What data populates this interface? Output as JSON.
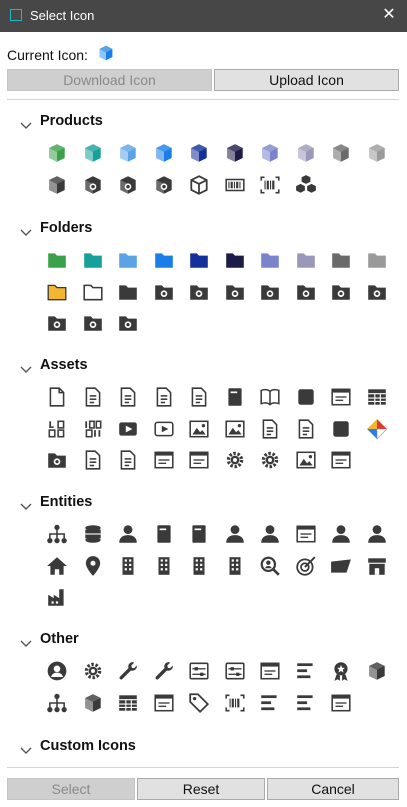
{
  "window": {
    "title": "Select Icon",
    "close_glyph": "✕"
  },
  "current": {
    "label": "Current Icon:",
    "icon": "cube-blue-icon"
  },
  "buttons": {
    "download": "Download Icon",
    "upload": "Upload Icon",
    "select": "Select",
    "reset": "Reset",
    "cancel": "Cancel"
  },
  "sections": [
    {
      "label": "Products",
      "icons": [
        {
          "name": "cube-green-icon",
          "kind": "cube",
          "color": "#3aa04a"
        },
        {
          "name": "cube-teal-icon",
          "kind": "cube",
          "color": "#16a09a"
        },
        {
          "name": "cube-lightblue-icon",
          "kind": "cube",
          "color": "#5aa4e6"
        },
        {
          "name": "cube-blue-icon",
          "kind": "cube",
          "color": "#1a7ee8"
        },
        {
          "name": "cube-navy-icon",
          "kind": "cube",
          "color": "#14309a"
        },
        {
          "name": "cube-darknavy-icon",
          "kind": "cube",
          "color": "#1c1c48"
        },
        {
          "name": "cube-periwinkle-icon",
          "kind": "cube",
          "color": "#7a84cc"
        },
        {
          "name": "cube-lavender-icon",
          "kind": "cube",
          "color": "#9a98b8"
        },
        {
          "name": "cube-gray-icon",
          "kind": "cube",
          "color": "#6a6a6a"
        },
        {
          "name": "cube-lightgray-icon",
          "kind": "cube",
          "color": "#9a9a9a"
        },
        {
          "name": "cube-dark-icon",
          "kind": "cube",
          "color": "#3a3a3a"
        },
        {
          "name": "cube-import-icon",
          "kind": "cube-badge",
          "color": "#3a3a3a"
        },
        {
          "name": "cube-star-icon",
          "kind": "cube-badge",
          "color": "#3a3a3a"
        },
        {
          "name": "cube-blocked-icon",
          "kind": "cube-badge",
          "color": "#3a3a3a"
        },
        {
          "name": "cube-outline-icon",
          "kind": "cube-outline",
          "color": "#3a3a3a"
        },
        {
          "name": "barcode-icon",
          "kind": "barcode",
          "color": "#3a3a3a"
        },
        {
          "name": "barcode-scan-icon",
          "kind": "barcode-scan",
          "color": "#3a3a3a"
        },
        {
          "name": "cubes-stack-icon",
          "kind": "cubes",
          "color": "#3a3a3a"
        }
      ]
    },
    {
      "label": "Folders",
      "icons": [
        {
          "name": "folder-green-icon",
          "kind": "folder",
          "color": "#3aa04a"
        },
        {
          "name": "folder-teal-icon",
          "kind": "folder",
          "color": "#16a09a"
        },
        {
          "name": "folder-lightblue-icon",
          "kind": "folder",
          "color": "#5aa4e6"
        },
        {
          "name": "folder-blue-icon",
          "kind": "folder",
          "color": "#1a7ee8"
        },
        {
          "name": "folder-navy-icon",
          "kind": "folder",
          "color": "#14309a"
        },
        {
          "name": "folder-darknavy-icon",
          "kind": "folder",
          "color": "#1c1c48"
        },
        {
          "name": "folder-periwinkle-icon",
          "kind": "folder",
          "color": "#7a84cc"
        },
        {
          "name": "folder-lavender-icon",
          "kind": "folder",
          "color": "#9a98b8"
        },
        {
          "name": "folder-gray-icon",
          "kind": "folder",
          "color": "#6a6a6a"
        },
        {
          "name": "folder-lightgray-icon",
          "kind": "folder",
          "color": "#9a9a9a"
        },
        {
          "name": "folder-yellow-icon",
          "kind": "folder-outlined",
          "color": "#f2b632"
        },
        {
          "name": "folder-outline-icon",
          "kind": "folder-empty",
          "color": "#3a3a3a"
        },
        {
          "name": "folder-dark-icon",
          "kind": "folder",
          "color": "#3a3a3a"
        },
        {
          "name": "folder-arrow-icon",
          "kind": "folder-badge",
          "color": "#3a3a3a"
        },
        {
          "name": "folder-star-icon",
          "kind": "folder-badge",
          "color": "#3a3a3a"
        },
        {
          "name": "folder-blocked-icon",
          "kind": "folder-badge",
          "color": "#3a3a3a"
        },
        {
          "name": "folder-code-icon",
          "kind": "folder-badge",
          "color": "#3a3a3a"
        },
        {
          "name": "folder-question-icon",
          "kind": "folder-badge",
          "color": "#3a3a3a"
        },
        {
          "name": "folder-dollar-icon",
          "kind": "folder-badge",
          "color": "#3a3a3a"
        },
        {
          "name": "folder-database-icon",
          "kind": "folder-badge",
          "color": "#3a3a3a"
        },
        {
          "name": "folder-user-icon",
          "kind": "folder-badge",
          "color": "#3a3a3a"
        },
        {
          "name": "folder-home-icon",
          "kind": "folder-badge",
          "color": "#3a3a3a"
        },
        {
          "name": "folder-location-icon",
          "kind": "folder-badge",
          "color": "#3a3a3a"
        }
      ]
    },
    {
      "label": "Assets",
      "icons": [
        {
          "name": "file-blank-icon",
          "kind": "file",
          "color": "#3a3a3a"
        },
        {
          "name": "file-list-icon",
          "kind": "file-lines",
          "color": "#3a3a3a"
        },
        {
          "name": "checklist-icon",
          "kind": "file-lines",
          "color": "#3a3a3a"
        },
        {
          "name": "file-text-icon",
          "kind": "file-lines",
          "color": "#3a3a3a"
        },
        {
          "name": "script-icon",
          "kind": "file-lines",
          "color": "#3a3a3a"
        },
        {
          "name": "book-icon",
          "kind": "solid-rect",
          "color": "#3a3a3a"
        },
        {
          "name": "open-book-icon",
          "kind": "book",
          "color": "#3a3a3a"
        },
        {
          "name": "presenter-icon",
          "kind": "generic",
          "color": "#3a3a3a"
        },
        {
          "name": "http-icon",
          "kind": "window",
          "color": "#3a3a3a"
        },
        {
          "name": "table-icon",
          "kind": "table",
          "color": "#3a3a3a"
        },
        {
          "name": "logo-text-icon",
          "kind": "text-logo",
          "color": "#3a3a3a"
        },
        {
          "name": "icon-text-icon",
          "kind": "text-icon",
          "color": "#3a3a3a"
        },
        {
          "name": "video-icon",
          "kind": "video",
          "color": "#3a3a3a"
        },
        {
          "name": "video-outline-icon",
          "kind": "video-outline",
          "color": "#3a3a3a"
        },
        {
          "name": "image-icon",
          "kind": "image",
          "color": "#3a3a3a"
        },
        {
          "name": "images-icon",
          "kind": "image",
          "color": "#3a3a3a"
        },
        {
          "name": "form-edit-icon",
          "kind": "file-lines",
          "color": "#3a3a3a"
        },
        {
          "name": "file-edit-icon",
          "kind": "file-lines",
          "color": "#3a3a3a"
        },
        {
          "name": "ruler-pencil-icon",
          "kind": "generic",
          "color": "#3a3a3a"
        },
        {
          "name": "color-diamond-icon",
          "kind": "diamond",
          "color": "#e05a2a"
        },
        {
          "name": "folder-settings-icon",
          "kind": "folder-badge",
          "color": "#3a3a3a"
        },
        {
          "name": "file-settings-icon",
          "kind": "file-lines",
          "color": "#3a3a3a"
        },
        {
          "name": "page-settings-icon",
          "kind": "file-lines",
          "color": "#3a3a3a"
        },
        {
          "name": "monitor-settings-icon",
          "kind": "window",
          "color": "#3a3a3a"
        },
        {
          "name": "terminal-icon",
          "kind": "window",
          "color": "#3a3a3a"
        },
        {
          "name": "sync-settings-icon",
          "kind": "gear",
          "color": "#3a3a3a"
        },
        {
          "name": "gear-icon",
          "kind": "gear",
          "color": "#3a3a3a"
        },
        {
          "name": "image-folder-icon",
          "kind": "image",
          "color": "#3a3a3a"
        },
        {
          "name": "window-list-icon",
          "kind": "window",
          "color": "#3a3a3a"
        }
      ]
    },
    {
      "label": "Entities",
      "icons": [
        {
          "name": "hierarchy-icon",
          "kind": "hierarchy",
          "color": "#3a3a3a"
        },
        {
          "name": "database-icon",
          "kind": "database",
          "color": "#3a3a3a"
        },
        {
          "name": "user-icon",
          "kind": "user",
          "color": "#3a3a3a"
        },
        {
          "name": "contact-book-icon",
          "kind": "solid-rect",
          "color": "#3a3a3a"
        },
        {
          "name": "contact-card-icon",
          "kind": "solid-rect",
          "color": "#3a3a3a"
        },
        {
          "name": "user-cart-icon",
          "kind": "user",
          "color": "#3a3a3a"
        },
        {
          "name": "user-email-icon",
          "kind": "user",
          "color": "#3a3a3a"
        },
        {
          "name": "id-card-icon",
          "kind": "window",
          "color": "#3a3a3a"
        },
        {
          "name": "users-icon",
          "kind": "user",
          "color": "#3a3a3a"
        },
        {
          "name": "user-handshake-icon",
          "kind": "user",
          "color": "#3a3a3a"
        },
        {
          "name": "home-icon",
          "kind": "home",
          "color": "#3a3a3a"
        },
        {
          "name": "location-pin-icon",
          "kind": "pin",
          "color": "#3a3a3a"
        },
        {
          "name": "city-map-icon",
          "kind": "building",
          "color": "#3a3a3a"
        },
        {
          "name": "buildings-icon",
          "kind": "building",
          "color": "#3a3a3a"
        },
        {
          "name": "office-building-icon",
          "kind": "building",
          "color": "#3a3a3a"
        },
        {
          "name": "hospital-icon",
          "kind": "building",
          "color": "#3a3a3a"
        },
        {
          "name": "search-user-icon",
          "kind": "search",
          "color": "#3a3a3a"
        },
        {
          "name": "target-icon",
          "kind": "target",
          "color": "#3a3a3a"
        },
        {
          "name": "flag-icon",
          "kind": "flag",
          "color": "#3a3a3a"
        },
        {
          "name": "storefront-icon",
          "kind": "store",
          "color": "#3a3a3a"
        },
        {
          "name": "factory-icon",
          "kind": "factory",
          "color": "#3a3a3a"
        }
      ]
    },
    {
      "label": "Other",
      "icons": [
        {
          "name": "user-circle-icon",
          "kind": "user-circle",
          "color": "#3a3a3a"
        },
        {
          "name": "gears-icon",
          "kind": "gear",
          "color": "#3a3a3a"
        },
        {
          "name": "wrench-icon",
          "kind": "wrench",
          "color": "#3a3a3a"
        },
        {
          "name": "tools-icon",
          "kind": "wrench",
          "color": "#3a3a3a"
        },
        {
          "name": "toggle-panel-icon",
          "kind": "sliders",
          "color": "#3a3a3a"
        },
        {
          "name": "sliders-icon",
          "kind": "sliders",
          "color": "#3a3a3a"
        },
        {
          "name": "dashboard-window-icon",
          "kind": "window",
          "color": "#3a3a3a"
        },
        {
          "name": "bar-list-icon",
          "kind": "bars",
          "color": "#3a3a3a"
        },
        {
          "name": "award-icon",
          "kind": "award",
          "color": "#3a3a3a"
        },
        {
          "name": "open-box-icon",
          "kind": "cube",
          "color": "#3a3a3a"
        },
        {
          "name": "hierarchy-boxes-icon",
          "kind": "hierarchy",
          "color": "#3a3a3a"
        },
        {
          "name": "package-icon",
          "kind": "cube",
          "color": "#3a3a3a"
        },
        {
          "name": "cart-grid-icon",
          "kind": "table",
          "color": "#3a3a3a"
        },
        {
          "name": "web-cart-icon",
          "kind": "window",
          "color": "#3a3a3a"
        },
        {
          "name": "tags-icon",
          "kind": "tag",
          "color": "#3a3a3a"
        },
        {
          "name": "scan-dollar-icon",
          "kind": "barcode-scan",
          "color": "#3a3a3a"
        },
        {
          "name": "list-a-icon",
          "kind": "bars",
          "color": "#3a3a3a"
        },
        {
          "name": "list-b-icon",
          "kind": "bars",
          "color": "#3a3a3a"
        },
        {
          "name": "calendar-box-icon",
          "kind": "window",
          "color": "#3a3a3a"
        }
      ]
    },
    {
      "label": "Custom Icons",
      "icons": []
    }
  ]
}
